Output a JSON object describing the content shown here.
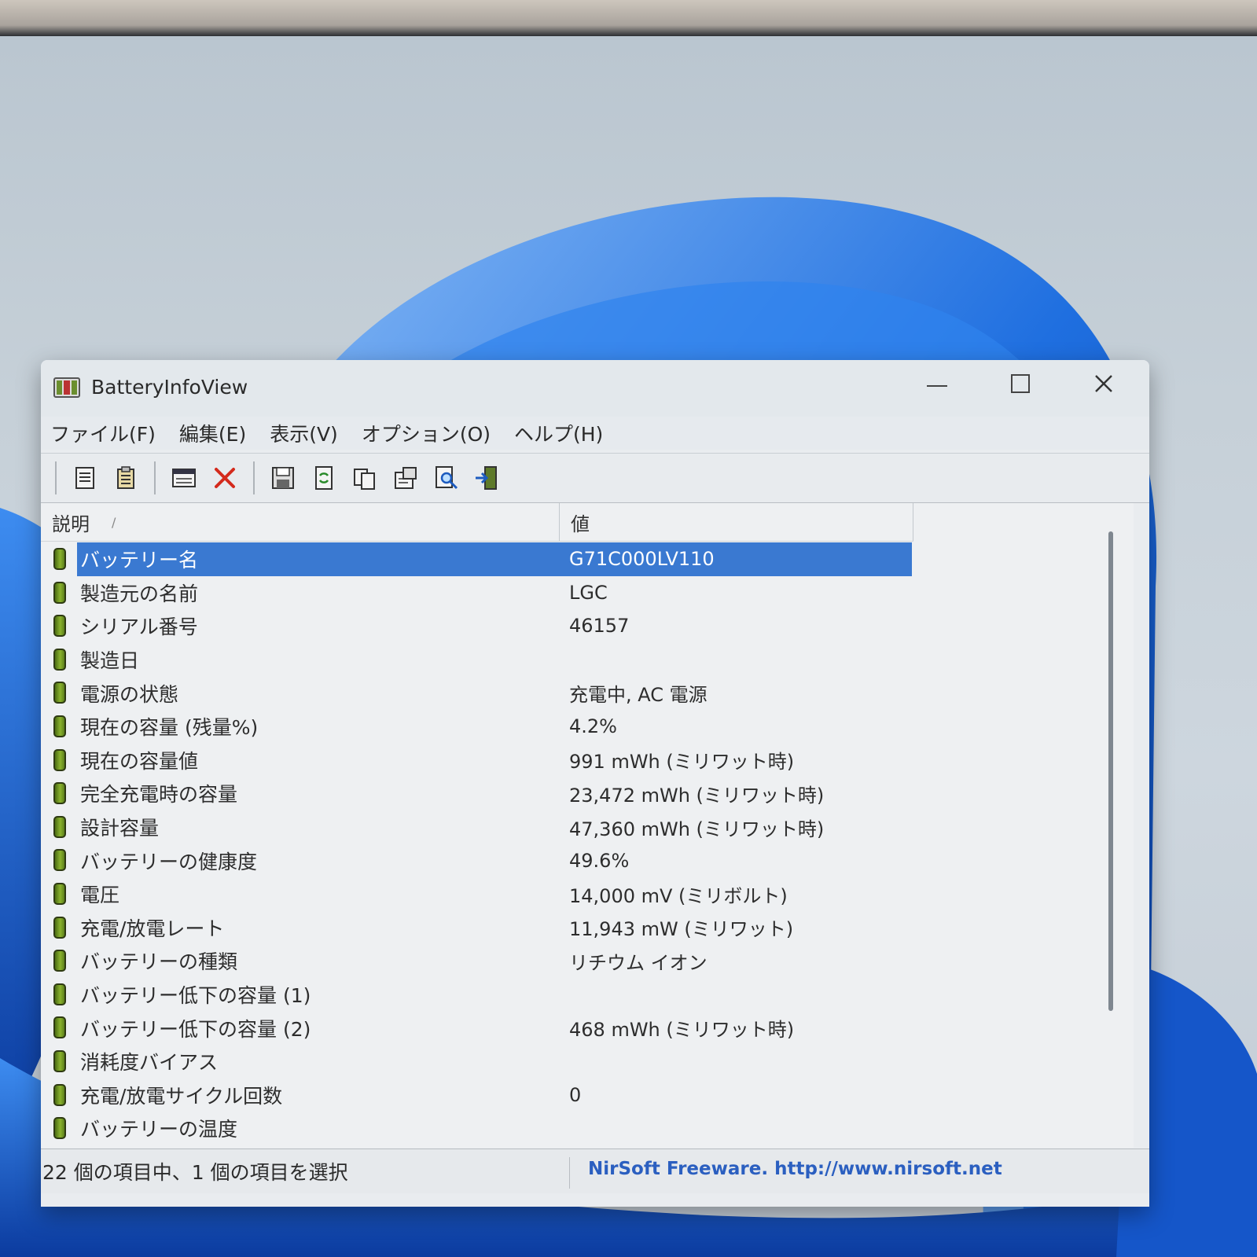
{
  "window": {
    "title": "BatteryInfoView"
  },
  "menu": [
    "ファイル(F)",
    "編集(E)",
    "表示(V)",
    "オプション(O)",
    "ヘルプ(H)"
  ],
  "toolbar": {
    "icons": [
      "properties-icon",
      "clipboard-icon",
      "window-icon",
      "delete-icon",
      "save-icon",
      "refresh-icon",
      "copy-icon",
      "options-icon",
      "find-icon",
      "exit-icon"
    ]
  },
  "columns": {
    "description": "説明",
    "description_sort_glyph": "/",
    "value": "値"
  },
  "rows": [
    {
      "desc": "バッテリー名",
      "value": "G71C000LV110",
      "selected": true
    },
    {
      "desc": "製造元の名前",
      "value": "LGC"
    },
    {
      "desc": "シリアル番号",
      "value": "46157"
    },
    {
      "desc": "製造日",
      "value": ""
    },
    {
      "desc": "電源の状態",
      "value": "充電中, AC 電源"
    },
    {
      "desc": "現在の容量 (残量%)",
      "value": "4.2%"
    },
    {
      "desc": "現在の容量値",
      "value": "991 mWh (ミリワット時)"
    },
    {
      "desc": "完全充電時の容量",
      "value": "23,472 mWh (ミリワット時)"
    },
    {
      "desc": "設計容量",
      "value": "47,360 mWh (ミリワット時)"
    },
    {
      "desc": "バッテリーの健康度",
      "value": "49.6%"
    },
    {
      "desc": "電圧",
      "value": "14,000 mV (ミリボルト)"
    },
    {
      "desc": "充電/放電レート",
      "value": "11,943 mW (ミリワット)"
    },
    {
      "desc": "バッテリーの種類",
      "value": "リチウム イオン"
    },
    {
      "desc": "バッテリー低下の容量 (1)",
      "value": ""
    },
    {
      "desc": "バッテリー低下の容量 (2)",
      "value": "468 mWh (ミリワット時)"
    },
    {
      "desc": "消耗度バイアス",
      "value": ""
    },
    {
      "desc": "充電/放電サイクル回数",
      "value": "0"
    },
    {
      "desc": "バッテリーの温度",
      "value": ""
    }
  ],
  "status": {
    "selection": "22 個の項目中、1 個の項目を選択",
    "credit": "NirSoft Freeware.  http://www.nirsoft.net"
  },
  "colors": {
    "selection": "#3a79d1",
    "link": "#2b5fc0",
    "battery_icon": "#6b9a22",
    "wallpaper_blue": "#1f6fe0"
  }
}
